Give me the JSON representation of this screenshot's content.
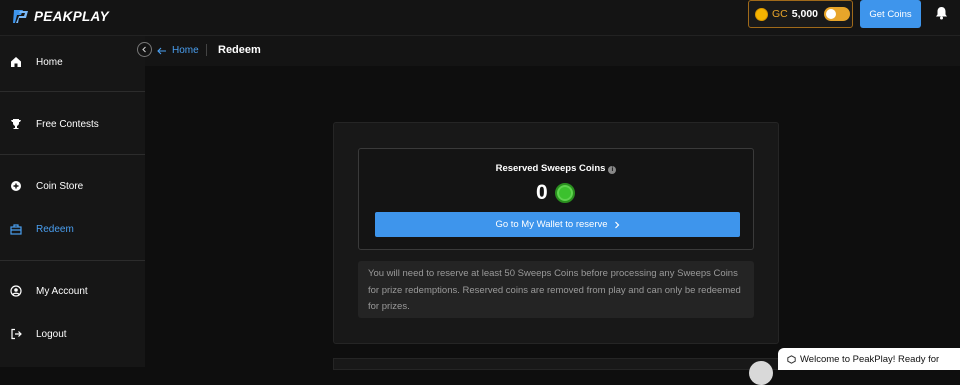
{
  "header": {
    "logo_text": "PEAKPLAY",
    "gc_label": "GC",
    "gc_balance": "5,000",
    "get_coins_label": "Get Coins"
  },
  "sidebar": {
    "items": [
      {
        "label": "Home",
        "icon": "home-icon"
      },
      {
        "label": "Free Contests",
        "icon": "trophy-icon"
      },
      {
        "label": "Coin Store",
        "icon": "plus-circle-icon"
      },
      {
        "label": "Redeem",
        "icon": "redeem-icon",
        "active": true
      },
      {
        "label": "My Account",
        "icon": "user-circle-icon"
      },
      {
        "label": "Logout",
        "icon": "logout-icon"
      }
    ]
  },
  "breadcrumb": {
    "home_label": "Home",
    "current": "Redeem"
  },
  "redeem": {
    "title": "Reserved Sweeps Coins",
    "value": "0",
    "wallet_button": "Go to My Wallet to reserve",
    "notice": "You will need to reserve at least 50 Sweeps Coins before processing any Sweeps Coins for prize redemptions. Reserved coins are removed from play and can only be redeemed for prizes."
  },
  "toast": {
    "text": "Welcome to PeakPlay! Ready for"
  },
  "colors": {
    "accent": "#3e95ec",
    "gold": "#e8a52a",
    "sweeps_green": "#3cc12e"
  }
}
